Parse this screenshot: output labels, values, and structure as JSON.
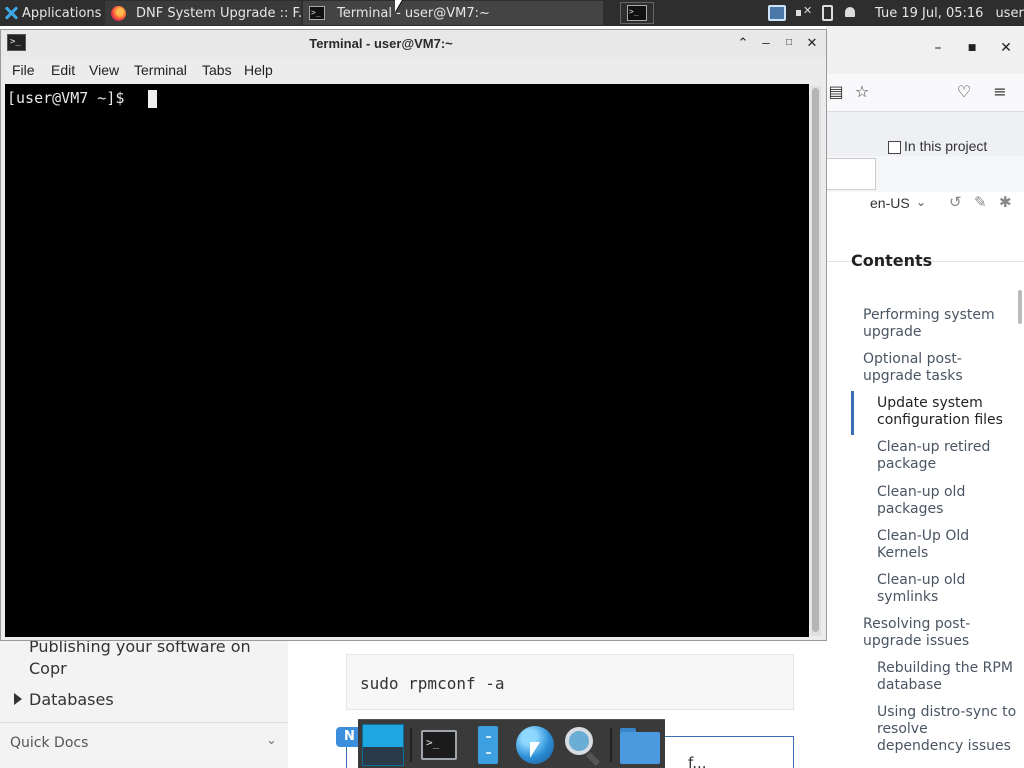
{
  "top_panel": {
    "apps_label": "Applications",
    "tasks": [
      {
        "label": "DNF System Upgrade :: F..."
      },
      {
        "label": "Terminal - user@VM7:~"
      }
    ],
    "clock": "Tue 19 Jul, 05:16",
    "user": "user"
  },
  "terminal": {
    "title": "Terminal - user@VM7:~",
    "menu": [
      "File",
      "Edit",
      "View",
      "Terminal",
      "Tabs",
      "Help"
    ],
    "prompt": "[user@VM7 ~]$ "
  },
  "browser": {
    "search_scope_label": "In this project",
    "language": "en-US",
    "toc": {
      "title": "Contents",
      "items": [
        {
          "label": "Performing system upgrade",
          "level": 1
        },
        {
          "label": "Optional post-upgrade tasks",
          "level": 1
        },
        {
          "label": "Update system configuration files",
          "level": 2,
          "active": true
        },
        {
          "label": "Clean-up retired package",
          "level": 2
        },
        {
          "label": "Clean-up old packages",
          "level": 2
        },
        {
          "label": "Clean-Up Old Kernels",
          "level": 2
        },
        {
          "label": "Clean-up old symlinks",
          "level": 2
        },
        {
          "label": "Resolving post-upgrade issues",
          "level": 1
        },
        {
          "label": "Rebuilding the RPM database",
          "level": 2
        },
        {
          "label": "Using distro-sync to resolve dependency issues",
          "level": 2
        }
      ]
    },
    "nav": {
      "item_publishing": "Publishing your software on Copr",
      "item_databases": "Databases",
      "quick_docs": "Quick Docs"
    },
    "content": {
      "code": "sudo rpmconf -a",
      "note_badge": "N",
      "note_tail": "f..."
    }
  },
  "colors": {
    "panel_bg": "#2e2e2e",
    "terminal_bg": "#000000",
    "accent": "#3c6eb4"
  }
}
